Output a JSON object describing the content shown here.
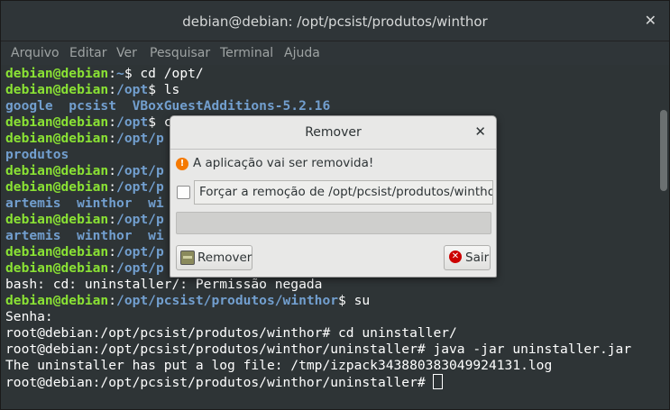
{
  "window": {
    "title": "debian@debian: /opt/pcsist/produtos/winthor",
    "close_glyph": "✕"
  },
  "menu": [
    "Arquivo",
    "Editar",
    "Ver",
    "Pesquisar",
    "Terminal",
    "Ajuda"
  ],
  "terminal": {
    "lines": [
      {
        "user": "debian@debian",
        "path": "~",
        "rest": "$ cd /opt/"
      },
      {
        "user": "debian@debian",
        "path": "/opt",
        "rest": "$ ls"
      },
      {
        "out_blue": "google  pcsist  VBoxGuestAdditions-5.2.16"
      },
      {
        "user": "debian@debian",
        "path": "/opt",
        "rest": "$ c"
      },
      {
        "user": "debian@debian",
        "path": "/opt/p",
        "rest": ""
      },
      {
        "out_blue": "produtos"
      },
      {
        "user": "debian@debian",
        "path": "/opt/p",
        "rest": ""
      },
      {
        "user": "debian@debian",
        "path": "/opt/p",
        "rest": ""
      },
      {
        "out_blue": "artemis  winthor  wi"
      },
      {
        "user": "debian@debian",
        "path": "/opt/p",
        "rest": ""
      },
      {
        "out_blue": "artemis  winthor  wi"
      },
      {
        "user": "debian@debian",
        "path": "/opt/p",
        "rest": ""
      },
      {
        "user": "debian@debian",
        "path": "/opt/p",
        "rest": ""
      },
      {
        "out_white": "bash: cd: uninstaller/: Permissão negada"
      },
      {
        "user": "debian@debian",
        "path": "/opt/pcsist/produtos/winthor",
        "rest": "$ su"
      },
      {
        "out_white": "Senha:"
      },
      {
        "out_white": "root@debian:/opt/pcsist/produtos/winthor# cd uninstaller/"
      },
      {
        "out_white": "root@debian:/opt/pcsist/produtos/winthor/uninstaller# java -jar uninstaller.jar"
      },
      {
        "out_white": "The uninstaller has put a log file: /tmp/izpack343880383049924131.log"
      },
      {
        "out_white": "root@debian:/opt/pcsist/produtos/winthor/uninstaller# ",
        "cursor": true
      }
    ]
  },
  "dialog": {
    "title": "Remover",
    "close_glyph": "✕",
    "warning_icon": "warning-icon",
    "message": "A aplicação vai ser removida!",
    "force_label": "Forçar a remoção de /opt/pcsist/produtos/winthor/",
    "force_checked": false,
    "progress": 0,
    "remove_button": "Remover",
    "exit_button": "Sair"
  }
}
